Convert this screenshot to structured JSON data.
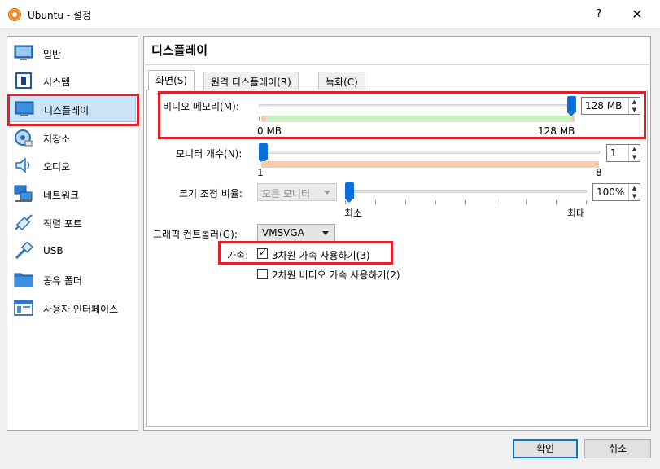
{
  "window": {
    "title": "Ubuntu - 설정",
    "help_label": "?",
    "close_label": "✕"
  },
  "sidebar": {
    "items": [
      {
        "label": "일반",
        "icon": "general-icon"
      },
      {
        "label": "시스템",
        "icon": "system-chip-icon"
      },
      {
        "label": "디스플레이",
        "icon": "monitor-icon",
        "selected": true
      },
      {
        "label": "저장소",
        "icon": "storage-disk-icon"
      },
      {
        "label": "오디오",
        "icon": "speaker-icon"
      },
      {
        "label": "네트워크",
        "icon": "network-icon"
      },
      {
        "label": "직렬 포트",
        "icon": "serial-port-icon"
      },
      {
        "label": "USB",
        "icon": "usb-icon"
      },
      {
        "label": "공유 폴더",
        "icon": "folder-icon"
      },
      {
        "label": "사용자 인터페이스",
        "icon": "user-interface-icon"
      }
    ]
  },
  "main": {
    "title": "디스플레이",
    "tabs": [
      {
        "label": "화면(S)",
        "active": true
      },
      {
        "label": "원격 디스플레이(R)"
      },
      {
        "label": "녹화(C)"
      }
    ],
    "video_memory": {
      "label": "비디오 메모리(M):",
      "value": "128 MB",
      "min_label": "0 MB",
      "max_label": "128 MB",
      "level": 1.0
    },
    "monitor_count": {
      "label": "모니터 개수(N):",
      "value": "1",
      "min_label": "1",
      "max_label": "8",
      "level": 0.0
    },
    "scale_factor": {
      "label": "크기 조정 비율:",
      "combo_value": "모든 모니터",
      "value": "100%",
      "min_label": "최소",
      "max_label": "최대",
      "level": 0.0
    },
    "graphics_controller": {
      "label": "그래픽 컨트롤러(G):",
      "value": "VMSVGA"
    },
    "acceleration": {
      "label": "가속:",
      "accel_3d_label": "3차원 가속 사용하기(3)",
      "accel_3d_checked": true,
      "accel_2d_label": "2차원 비디오 가속 사용하기(2)",
      "accel_2d_checked": false
    }
  },
  "footer": {
    "ok_label": "확인",
    "cancel_label": "취소"
  },
  "colors": {
    "highlight_red": "#e0202a",
    "selection_blue": "#cce4f7",
    "slider_blue": "#0a6fd8",
    "range_green": "#c8f0c0",
    "range_orange": "#f8cdb0"
  }
}
